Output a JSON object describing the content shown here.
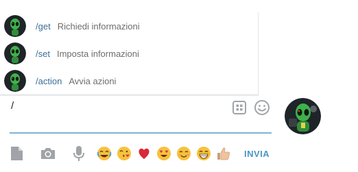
{
  "commands": [
    {
      "name": "/get",
      "description": "Richiedi informazioni"
    },
    {
      "name": "/set",
      "description": "Imposta informazioni"
    },
    {
      "name": "/action",
      "description": "Avvia azioni"
    }
  ],
  "input": {
    "value": "/"
  },
  "toolbar": {
    "icons": [
      "attach-file-icon",
      "camera-icon",
      "microphone-icon"
    ],
    "send_label": "INVIA"
  },
  "input_icons": [
    "bot-commands-icon",
    "emoji-panel-icon"
  ],
  "quick_emoji": [
    "😂",
    "😘",
    "❤️",
    "😍",
    "😊",
    "😁",
    "👍🏻"
  ],
  "colors": {
    "command_name": "#3a6d99",
    "description": "#6d6d6d",
    "input_underline": "#7ab6d1",
    "send": "#4a95c9",
    "icon_gray": "#a0a4a8"
  }
}
